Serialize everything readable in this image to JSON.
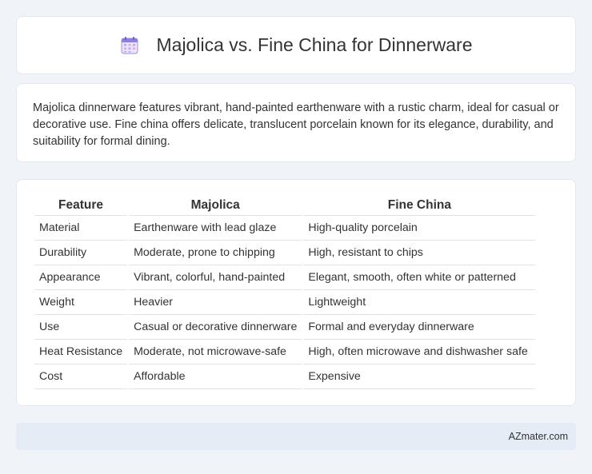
{
  "header": {
    "title": "Majolica vs. Fine China for Dinnerware",
    "icon": "calendar-icon"
  },
  "description": "Majolica dinnerware features vibrant, hand-painted earthenware with a rustic charm, ideal for casual or decorative use. Fine china offers delicate, translucent porcelain known for its elegance, durability, and suitability for formal dining.",
  "table": {
    "headers": [
      "Feature",
      "Majolica",
      "Fine China"
    ],
    "rows": [
      [
        "Material",
        "Earthenware with lead glaze",
        "High-quality porcelain"
      ],
      [
        "Durability",
        "Moderate, prone to chipping",
        "High, resistant to chips"
      ],
      [
        "Appearance",
        "Vibrant, colorful, hand-painted",
        "Elegant, smooth, often white or patterned"
      ],
      [
        "Weight",
        "Heavier",
        "Lightweight"
      ],
      [
        "Use",
        "Casual or decorative dinnerware",
        "Formal and everyday dinnerware"
      ],
      [
        "Heat Resistance",
        "Moderate, not microwave-safe",
        "High, often microwave and dishwasher safe"
      ],
      [
        "Cost",
        "Affordable",
        "Expensive"
      ]
    ]
  },
  "footer": {
    "credit": "AZmater.com"
  },
  "colors": {
    "background": "#f0f3f8",
    "card": "#ffffff",
    "footer": "#e6ecf6",
    "icon_accent": "#7b68c9"
  }
}
